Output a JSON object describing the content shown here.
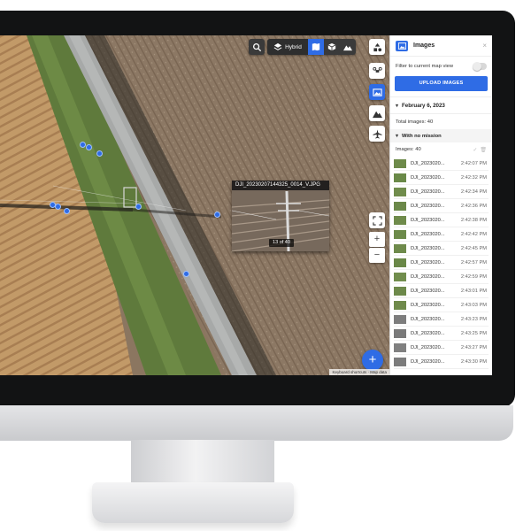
{
  "map": {
    "layer_label": "Hybrid",
    "photo_popup": {
      "filename": "DJI_20230207144325_0014_V.JPG",
      "counter": "13 of 40"
    },
    "zoom_in": "+",
    "zoom_out": "−",
    "fab_label": "+",
    "attribution": "Keyboard shortcuts · Map data"
  },
  "panel": {
    "title": "Images",
    "close": "×",
    "filter_label": "Filter to current map view",
    "upload_label": "UPLOAD IMAGES",
    "date_group": "February 6, 2023",
    "total_images": "Total images: 40",
    "mission_group": "With no mission",
    "images_count": "Images: 40",
    "images": [
      {
        "name": "DJI_2023020...",
        "time": "2:42:07 PM",
        "thumb": "#6d8a4a"
      },
      {
        "name": "DJI_2023020...",
        "time": "2:42:32 PM",
        "thumb": "#6a8948"
      },
      {
        "name": "DJI_2023020...",
        "time": "2:42:34 PM",
        "thumb": "#708c4c"
      },
      {
        "name": "DJI_2023020...",
        "time": "2:42:36 PM",
        "thumb": "#6b8849"
      },
      {
        "name": "DJI_2023020...",
        "time": "2:42:38 PM",
        "thumb": "#6f8b4b"
      },
      {
        "name": "DJI_2023020...",
        "time": "2:42:42 PM",
        "thumb": "#6c8a4a"
      },
      {
        "name": "DJI_2023020...",
        "time": "2:42:45 PM",
        "thumb": "#6e8a4b"
      },
      {
        "name": "DJI_2023020...",
        "time": "2:42:57 PM",
        "thumb": "#6a8848"
      },
      {
        "name": "DJI_2023020...",
        "time": "2:42:59 PM",
        "thumb": "#718d4d"
      },
      {
        "name": "DJI_2023020...",
        "time": "2:43:01 PM",
        "thumb": "#6d894a"
      },
      {
        "name": "DJI_2023020...",
        "time": "2:43:03 PM",
        "thumb": "#6f8a4b"
      },
      {
        "name": "DJI_2023020...",
        "time": "2:43:23 PM",
        "thumb": "#7d7d7d"
      },
      {
        "name": "DJI_2023020...",
        "time": "2:43:25 PM",
        "thumb": "#7a7a7a"
      },
      {
        "name": "DJI_2023020...",
        "time": "2:43:27 PM",
        "thumb": "#808080"
      },
      {
        "name": "DJI_2023020...",
        "time": "2:43:30 PM",
        "thumb": "#7c7c7c"
      }
    ]
  },
  "colors": {
    "accent": "#2f6ce5",
    "panel_bg": "#ffffff",
    "bezel": "#121314"
  },
  "icons": {
    "search": "search-icon",
    "layers": "layers-icon",
    "map_view": "map-view-icon",
    "3d_view": "cube-icon",
    "terrain": "terrain-icon",
    "drone": "drone-icon",
    "images": "images-icon",
    "mountain": "mountain-icon",
    "plane": "plane-icon",
    "fullscreen": "fullscreen-icon"
  }
}
